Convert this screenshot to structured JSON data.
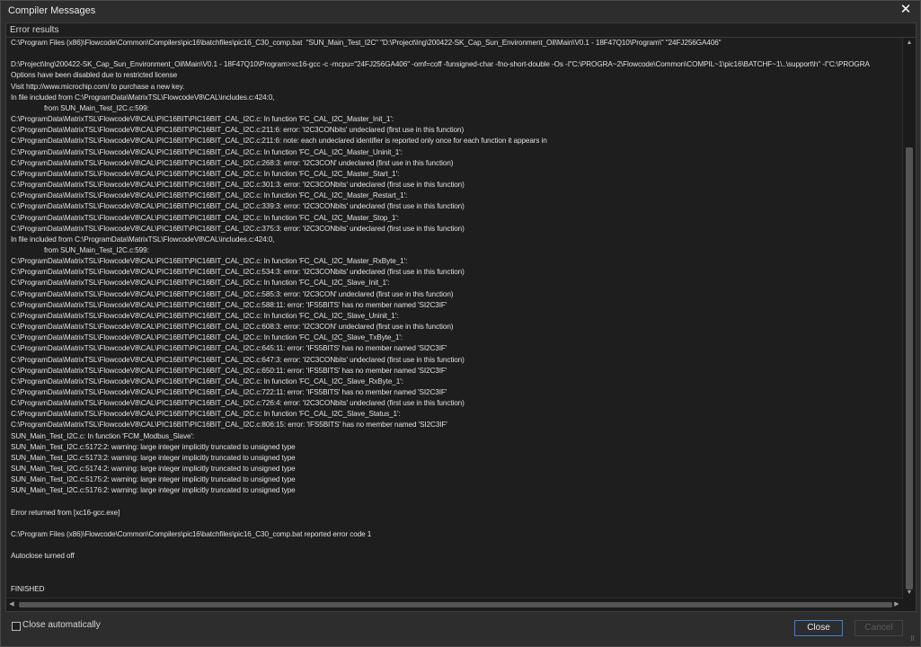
{
  "window": {
    "title": "Compiler Messages",
    "close_glyph": "✕"
  },
  "results": {
    "header": "Error results",
    "log": "C:\\Program Files (x86)\\Flowcode\\Common\\Compilers\\pic16\\batchfiles\\pic16_C30_comp.bat  \"SUN_Main_Test_I2C\" \"D:\\Project\\Ing\\200422-SK_Cap_Sun_Environment_Oil\\Main\\V0.1 - 18F47Q10\\Program\\\" \"24FJ256GA406\"\n\nD:\\Project\\Ing\\200422-SK_Cap_Sun_Environment_Oil\\Main\\V0.1 - 18F47Q10\\Program>xc16-gcc -c -mcpu=\"24FJ256GA406\" -omf=coff -funsigned-char -fno-short-double -Os -I\"C:\\PROGRA~2\\Flowcode\\Common\\COMPIL~1\\pic16\\BATCHF~1\\..\\support\\h\" -I\"C:\\PROGRA\nOptions have been disabled due to restricted license\nVisit http://www.microchip.com/ to purchase a new key.\nIn file included from C:\\ProgramData\\MatrixTSL\\FlowcodeV8\\CAL\\includes.c:424:0,\n                 from SUN_Main_Test_I2C.c:599:\nC:\\ProgramData\\MatrixTSL\\FlowcodeV8\\CAL\\PIC16BIT\\PIC16BIT_CAL_I2C.c: In function 'FC_CAL_I2C_Master_Init_1':\nC:\\ProgramData\\MatrixTSL\\FlowcodeV8\\CAL\\PIC16BIT\\PIC16BIT_CAL_I2C.c:211:6: error: 'I2C3CONbits' undeclared (first use in this function)\nC:\\ProgramData\\MatrixTSL\\FlowcodeV8\\CAL\\PIC16BIT\\PIC16BIT_CAL_I2C.c:211:6: note: each undeclared identifier is reported only once for each function it appears in\nC:\\ProgramData\\MatrixTSL\\FlowcodeV8\\CAL\\PIC16BIT\\PIC16BIT_CAL_I2C.c: In function 'FC_CAL_I2C_Master_Uninit_1':\nC:\\ProgramData\\MatrixTSL\\FlowcodeV8\\CAL\\PIC16BIT\\PIC16BIT_CAL_I2C.c:268:3: error: 'I2C3CON' undeclared (first use in this function)\nC:\\ProgramData\\MatrixTSL\\FlowcodeV8\\CAL\\PIC16BIT\\PIC16BIT_CAL_I2C.c: In function 'FC_CAL_I2C_Master_Start_1':\nC:\\ProgramData\\MatrixTSL\\FlowcodeV8\\CAL\\PIC16BIT\\PIC16BIT_CAL_I2C.c:301:3: error: 'I2C3CONbits' undeclared (first use in this function)\nC:\\ProgramData\\MatrixTSL\\FlowcodeV8\\CAL\\PIC16BIT\\PIC16BIT_CAL_I2C.c: In function 'FC_CAL_I2C_Master_Restart_1':\nC:\\ProgramData\\MatrixTSL\\FlowcodeV8\\CAL\\PIC16BIT\\PIC16BIT_CAL_I2C.c:339:3: error: 'I2C3CONbits' undeclared (first use in this function)\nC:\\ProgramData\\MatrixTSL\\FlowcodeV8\\CAL\\PIC16BIT\\PIC16BIT_CAL_I2C.c: In function 'FC_CAL_I2C_Master_Stop_1':\nC:\\ProgramData\\MatrixTSL\\FlowcodeV8\\CAL\\PIC16BIT\\PIC16BIT_CAL_I2C.c:375:3: error: 'I2C3CONbits' undeclared (first use in this function)\nIn file included from C:\\ProgramData\\MatrixTSL\\FlowcodeV8\\CAL\\includes.c:424:0,\n                 from SUN_Main_Test_I2C.c:599:\nC:\\ProgramData\\MatrixTSL\\FlowcodeV8\\CAL\\PIC16BIT\\PIC16BIT_CAL_I2C.c: In function 'FC_CAL_I2C_Master_RxByte_1':\nC:\\ProgramData\\MatrixTSL\\FlowcodeV8\\CAL\\PIC16BIT\\PIC16BIT_CAL_I2C.c:534:3: error: 'I2C3CONbits' undeclared (first use in this function)\nC:\\ProgramData\\MatrixTSL\\FlowcodeV8\\CAL\\PIC16BIT\\PIC16BIT_CAL_I2C.c: In function 'FC_CAL_I2C_Slave_Init_1':\nC:\\ProgramData\\MatrixTSL\\FlowcodeV8\\CAL\\PIC16BIT\\PIC16BIT_CAL_I2C.c:585:3: error: 'I2C3CON' undeclared (first use in this function)\nC:\\ProgramData\\MatrixTSL\\FlowcodeV8\\CAL\\PIC16BIT\\PIC16BIT_CAL_I2C.c:588:11: error: 'IFS5BITS' has no member named 'SI2C3IF'\nC:\\ProgramData\\MatrixTSL\\FlowcodeV8\\CAL\\PIC16BIT\\PIC16BIT_CAL_I2C.c: In function 'FC_CAL_I2C_Slave_Uninit_1':\nC:\\ProgramData\\MatrixTSL\\FlowcodeV8\\CAL\\PIC16BIT\\PIC16BIT_CAL_I2C.c:608:3: error: 'I2C3CON' undeclared (first use in this function)\nC:\\ProgramData\\MatrixTSL\\FlowcodeV8\\CAL\\PIC16BIT\\PIC16BIT_CAL_I2C.c: In function 'FC_CAL_I2C_Slave_TxByte_1':\nC:\\ProgramData\\MatrixTSL\\FlowcodeV8\\CAL\\PIC16BIT\\PIC16BIT_CAL_I2C.c:645:11: error: 'IFS5BITS' has no member named 'SI2C3IF'\nC:\\ProgramData\\MatrixTSL\\FlowcodeV8\\CAL\\PIC16BIT\\PIC16BIT_CAL_I2C.c:647:3: error: 'I2C3CONbits' undeclared (first use in this function)\nC:\\ProgramData\\MatrixTSL\\FlowcodeV8\\CAL\\PIC16BIT\\PIC16BIT_CAL_I2C.c:650:11: error: 'IFS5BITS' has no member named 'SI2C3IF'\nC:\\ProgramData\\MatrixTSL\\FlowcodeV8\\CAL\\PIC16BIT\\PIC16BIT_CAL_I2C.c: In function 'FC_CAL_I2C_Slave_RxByte_1':\nC:\\ProgramData\\MatrixTSL\\FlowcodeV8\\CAL\\PIC16BIT\\PIC16BIT_CAL_I2C.c:722:11: error: 'IFS5BITS' has no member named 'SI2C3IF'\nC:\\ProgramData\\MatrixTSL\\FlowcodeV8\\CAL\\PIC16BIT\\PIC16BIT_CAL_I2C.c:726:4: error: 'I2C3CONbits' undeclared (first use in this function)\nC:\\ProgramData\\MatrixTSL\\FlowcodeV8\\CAL\\PIC16BIT\\PIC16BIT_CAL_I2C.c: In function 'FC_CAL_I2C_Slave_Status_1':\nC:\\ProgramData\\MatrixTSL\\FlowcodeV8\\CAL\\PIC16BIT\\PIC16BIT_CAL_I2C.c:806:15: error: 'IFS5BITS' has no member named 'SI2C3IF'\nSUN_Main_Test_I2C.c: In function 'FCM_Modbus_Slave':\nSUN_Main_Test_I2C.c:5172:2: warning: large integer implicitly truncated to unsigned type\nSUN_Main_Test_I2C.c:5173:2: warning: large integer implicitly truncated to unsigned type\nSUN_Main_Test_I2C.c:5174:2: warning: large integer implicitly truncated to unsigned type\nSUN_Main_Test_I2C.c:5175:2: warning: large integer implicitly truncated to unsigned type\nSUN_Main_Test_I2C.c:5176:2: warning: large integer implicitly truncated to unsigned type\n\nError returned from [xc16-gcc.exe]\n\nC:\\Program Files (x86)\\Flowcode\\Common\\Compilers\\pic16\\batchfiles\\pic16_C30_comp.bat reported error code 1\n\nAutoclose turned off\n\n\nFINISHED"
  },
  "scrollbars": {
    "up_glyph": "▲",
    "down_glyph": "▼",
    "left_glyph": "◀",
    "right_glyph": "▶"
  },
  "footer": {
    "close_automatically_label": "Close automatically",
    "close_automatically_checked": false,
    "close_button": "Close",
    "cancel_button": "Cancel",
    "grip_glyph": "⠿"
  },
  "colors": {
    "window_bg": "#2d2d2d",
    "panel_bg": "#1e1e1e",
    "accent_border": "#3d7fd6",
    "text": "#e0e0e0",
    "disabled_text": "#5c5c5c"
  }
}
